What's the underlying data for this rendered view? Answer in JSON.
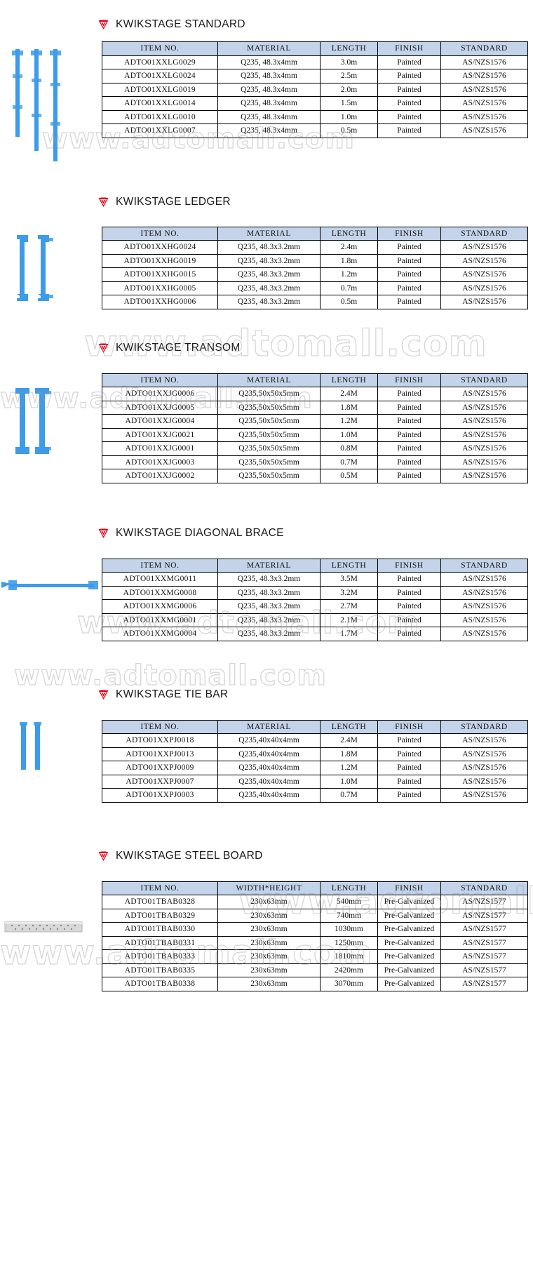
{
  "meta": {
    "watermark_text": "www.adtomall.com",
    "header_bg": "#c3d4ea",
    "logo_color": "#e2001a",
    "part_color": "#3d9be9"
  },
  "columns": {
    "item": "ITEM NO.",
    "material": "MATERIAL",
    "width_height": "WIDTH*HEIGHT",
    "length": "LENGTH",
    "finish": "FINISH",
    "standard": "STANDARD"
  },
  "sections": [
    {
      "id": "standard",
      "title": "KWIKSTAGE STANDARD",
      "headers": [
        "ITEM NO.",
        "MATERIAL",
        "LENGTH",
        "FINISH",
        "STANDARD"
      ],
      "rows": [
        [
          "ADTO01XXLG0029",
          "Q235, 48.3x4mm",
          "3.0m",
          "Painted",
          "AS/NZS1576"
        ],
        [
          "ADTO01XXLG0024",
          "Q235, 48.3x4mm",
          "2.5m",
          "Painted",
          "AS/NZS1576"
        ],
        [
          "ADTO01XXLG0019",
          "Q235, 48.3x4mm",
          "2.0m",
          "Painted",
          "AS/NZS1576"
        ],
        [
          "ADTO01XXLG0014",
          "Q235, 48.3x4mm",
          "1.5m",
          "Painted",
          "AS/NZS1576"
        ],
        [
          "ADTO01XXLG0010",
          "Q235, 48.3x4mm",
          "1.0m",
          "Painted",
          "AS/NZS1576"
        ],
        [
          "ADTO01XXLG0007",
          "Q235, 48.3x4mm",
          "0.5m",
          "Painted",
          "AS/NZS1576"
        ]
      ]
    },
    {
      "id": "ledger",
      "title": "KWIKSTAGE LEDGER",
      "headers": [
        "ITEM NO.",
        "MATERIAL",
        "LENGTH",
        "FINISH",
        "STANDARD"
      ],
      "rows": [
        [
          "ADTO01XXHG0024",
          "Q235, 48.3x3.2mm",
          "2.4m",
          "Painted",
          "AS/NZS1576"
        ],
        [
          "ADTO01XXHG0019",
          "Q235, 48.3x3.2mm",
          "1.8m",
          "Painted",
          "AS/NZS1576"
        ],
        [
          "ADTO01XXHG0015",
          "Q235, 48.3x3.2mm",
          "1.2m",
          "Painted",
          "AS/NZS1576"
        ],
        [
          "ADTO01XXHG0005",
          "Q235, 48.3x3.2mm",
          "0.7m",
          "Painted",
          "AS/NZS1576"
        ],
        [
          "ADTO01XXHG0006",
          "Q235, 48.3x3.2mm",
          "0.5m",
          "Painted",
          "AS/NZS1576"
        ]
      ]
    },
    {
      "id": "transom",
      "title": "KWIKSTAGE TRANSOM",
      "headers": [
        "ITEM NO.",
        "MATERIAL",
        "LENGTH",
        "FINISH",
        "STANDARD"
      ],
      "rows": [
        [
          "ADTO01XXJG0006",
          "Q235,50x50x5mm",
          "2.4M",
          "Painted",
          "AS/NZS1576"
        ],
        [
          "ADTO01XXJG0005",
          "Q235,50x50x5mm",
          "1.8M",
          "Painted",
          "AS/NZS1576"
        ],
        [
          "ADTO01XXJG0004",
          "Q235,50x50x5mm",
          "1.2M",
          "Painted",
          "AS/NZS1576"
        ],
        [
          "ADTO01XXJG0021",
          "Q235,50x50x5mm",
          "1.0M",
          "Painted",
          "AS/NZS1576"
        ],
        [
          "ADTO01XXJG0001",
          "Q235,50x50x5mm",
          "0.8M",
          "Painted",
          "AS/NZS1576"
        ],
        [
          "ADTO01XXJG0003",
          "Q235,50x50x5mm",
          "0.7M",
          "Painted",
          "AS/NZS1576"
        ],
        [
          "ADTO01XXJG0002",
          "Q235,50x50x5mm",
          "0.5M",
          "Painted",
          "AS/NZS1576"
        ]
      ]
    },
    {
      "id": "diagonal-brace",
      "title": "KWIKSTAGE DIAGONAL BRACE",
      "headers": [
        "ITEM NO.",
        "MATERIAL",
        "LENGTH",
        "FINISH",
        "STANDARD"
      ],
      "rows": [
        [
          "ADTO01XXMG0011",
          "Q235, 48.3x3.2mm",
          "3.5M",
          "Painted",
          "AS/NZS1576"
        ],
        [
          "ADTO01XXMG0008",
          "Q235, 48.3x3.2mm",
          "3.2M",
          "Painted",
          "AS/NZS1576"
        ],
        [
          "ADTO01XXMG0006",
          "Q235, 48.3x3.2mm",
          "2.7M",
          "Painted",
          "AS/NZS1576"
        ],
        [
          "ADTO01XXMG0001",
          "Q235, 48.3x3.2mm",
          "2.1M",
          "Painted",
          "AS/NZS1576"
        ],
        [
          "ADTO01XXMG0004",
          "Q235, 48.3x3.2mm",
          "1.7M",
          "Painted",
          "AS/NZS1576"
        ]
      ]
    },
    {
      "id": "tie-bar",
      "title": "KWIKSTAGE TIE BAR",
      "headers": [
        "ITEM NO.",
        "MATERIAL",
        "LENGTH",
        "FINISH",
        "STANDARD"
      ],
      "rows": [
        [
          "ADTO01XXPJ0018",
          "Q235,40x40x4mm",
          "2.4M",
          "Painted",
          "AS/NZS1576"
        ],
        [
          "ADTO01XXPJ0013",
          "Q235,40x40x4mm",
          "1.8M",
          "Painted",
          "AS/NZS1576"
        ],
        [
          "ADTO01XXPJ0009",
          "Q235,40x40x4mm",
          "1.2M",
          "Painted",
          "AS/NZS1576"
        ],
        [
          "ADTO01XXPJ0007",
          "Q235,40x40x4mm",
          "1.0M",
          "Painted",
          "AS/NZS1576"
        ],
        [
          "ADTO01XXPJ0003",
          "Q235,40x40x4mm",
          "0.7M",
          "Painted",
          "AS/NZS1576"
        ]
      ]
    },
    {
      "id": "steel-board",
      "title": "KWIKSTAGE STEEL BOARD",
      "headers": [
        "ITEM NO.",
        "WIDTH*HEIGHT",
        "LENGTH",
        "FINISH",
        "STANDARD"
      ],
      "rows": [
        [
          "ADTO01TBAB0328",
          "230x63mm",
          "540mm",
          "Pre-Galvanized",
          "AS/NZS1577"
        ],
        [
          "ADTO01TBAB0329",
          "230x63mm",
          "740mm",
          "Pre-Galvanized",
          "AS/NZS1577"
        ],
        [
          "ADTO01TBAB0330",
          "230x63mm",
          "1030mm",
          "Pre-Galvanized",
          "AS/NZS1577"
        ],
        [
          "ADTO01TBAB0331",
          "230x63mm",
          "1250mm",
          "Pre-Galvanized",
          "AS/NZS1577"
        ],
        [
          "ADTO01TBAB0333",
          "230x63mm",
          "1810mm",
          "Pre-Galvanized",
          "AS/NZS1577"
        ],
        [
          "ADTO01TBAB0335",
          "230x63mm",
          "2420mm",
          "Pre-Galvanized",
          "AS/NZS1577"
        ],
        [
          "ADTO01TBAB0338",
          "230x63mm",
          "3070mm",
          "Pre-Galvanized",
          "AS/NZS1577"
        ]
      ]
    }
  ]
}
